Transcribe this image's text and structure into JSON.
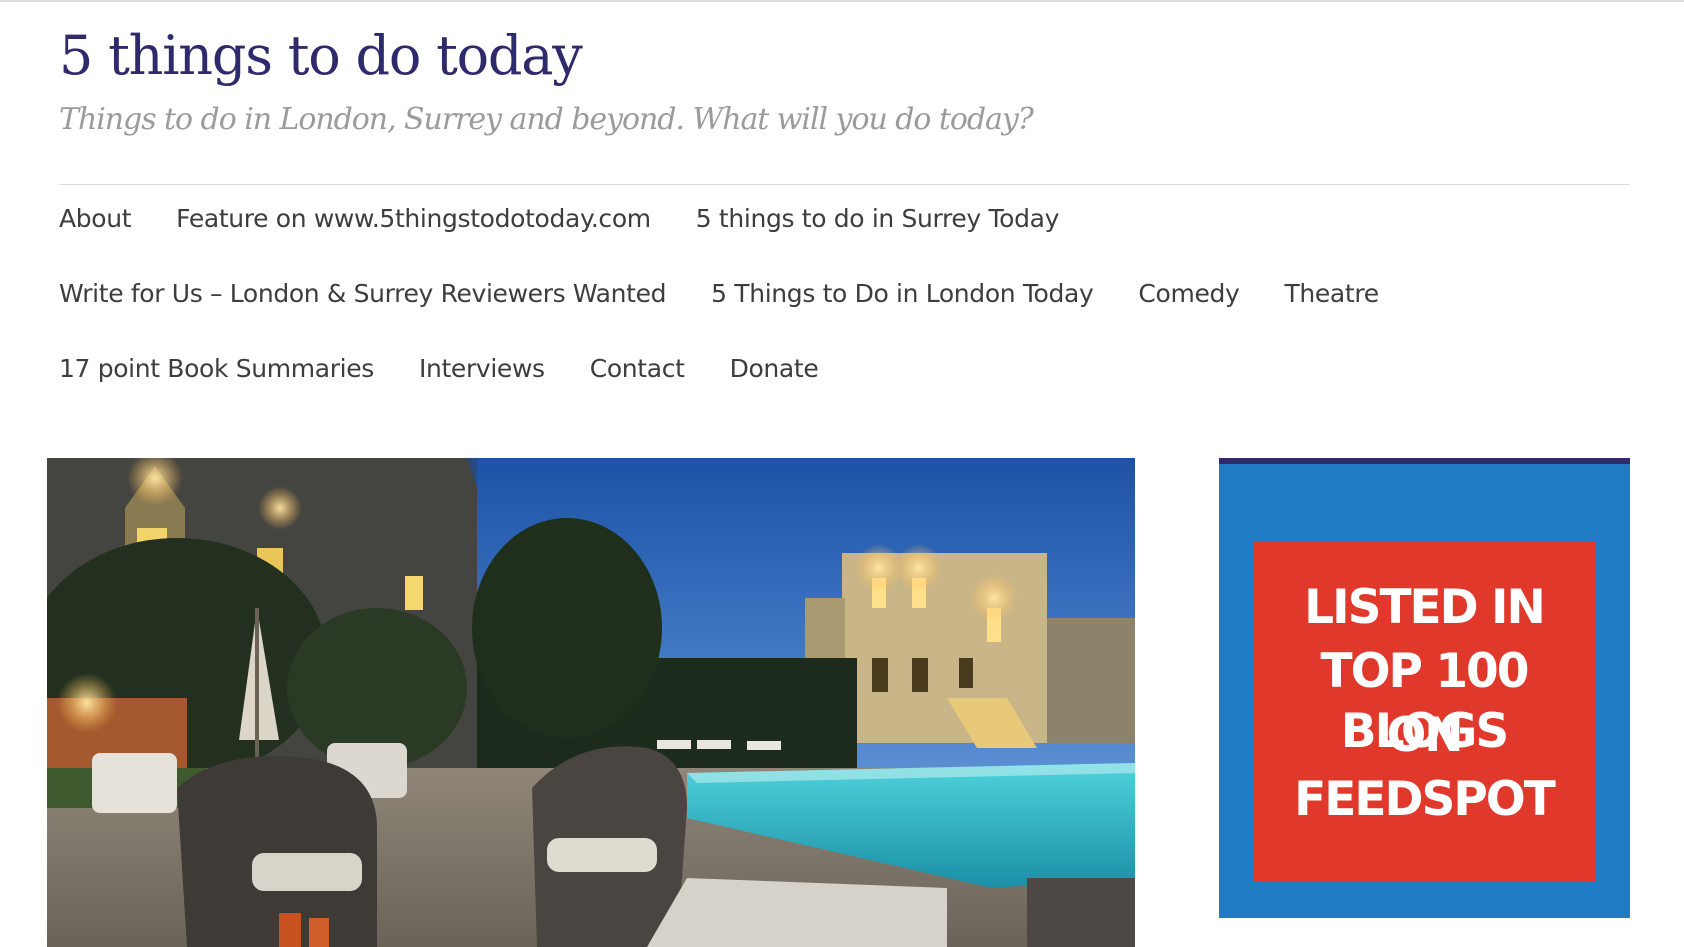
{
  "site": {
    "title": "5 things to do today",
    "tagline": "Things to do in London, Surrey and beyond. What will you do today?"
  },
  "nav": {
    "rows": [
      [
        "About",
        "Feature on www.5thingstodotoday.com",
        "5 things to do in Surrey Today"
      ],
      [
        "Write for Us – London & Surrey Reviewers Wanted",
        "5 Things to Do in London Today",
        "Comedy",
        "Theatre"
      ],
      [
        "17 point Book Summaries",
        "Interviews",
        "Contact",
        "Donate"
      ]
    ]
  },
  "badge": {
    "lines": [
      "LISTED IN",
      "TOP 100 BLOGS",
      "ON",
      "FEEDSPOT"
    ]
  },
  "colors": {
    "title": "#2e2a6b",
    "tagline": "#9b9b9b",
    "nav_text": "#3d3d3d",
    "badge_blue": "#1f7cc4",
    "badge_red": "#e0392b"
  },
  "icons": {
    "hero": "night-pool-villa-photo",
    "badge": "feedspot-badge"
  }
}
